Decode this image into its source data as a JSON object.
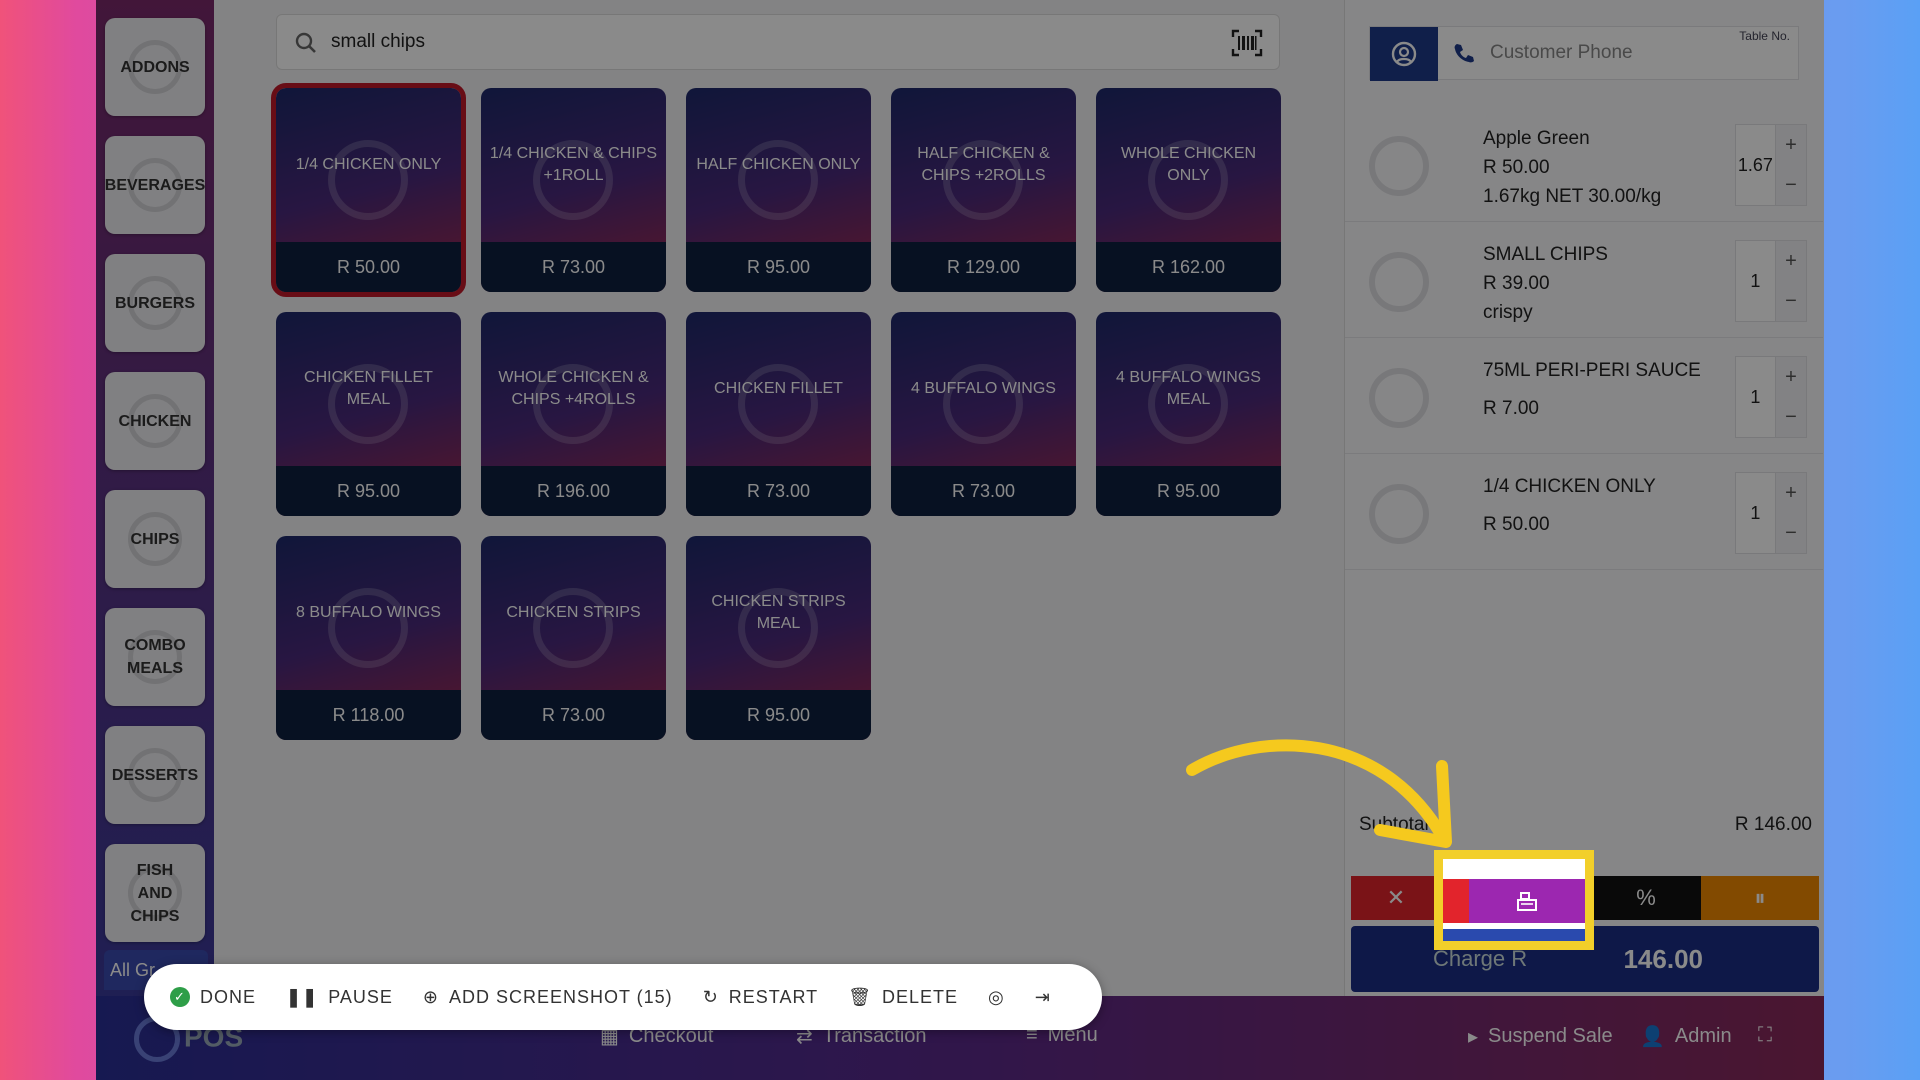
{
  "sidebar": {
    "categories": [
      "ADDONS",
      "BEVERAGES",
      "BURGERS",
      "CHICKEN",
      "CHIPS",
      "COMBO MEALS",
      "DESSERTS",
      "FISH AND CHIPS"
    ],
    "all_groups": "All Gr"
  },
  "search": {
    "value": "small chips"
  },
  "products": [
    {
      "name": "1/4 CHICKEN ONLY",
      "price": "R 50.00"
    },
    {
      "name": "1/4 CHICKEN & CHIPS +1ROLL",
      "price": "R 73.00"
    },
    {
      "name": "HALF CHICKEN ONLY",
      "price": "R 95.00"
    },
    {
      "name": "HALF CHICKEN & CHIPS +2ROLLS",
      "price": "R 129.00"
    },
    {
      "name": "WHOLE CHICKEN ONLY",
      "price": "R 162.00"
    },
    {
      "name": "CHICKEN FILLET MEAL",
      "price": "R 95.00"
    },
    {
      "name": "WHOLE CHICKEN & CHIPS +4ROLLS",
      "price": "R 196.00"
    },
    {
      "name": "CHICKEN FILLET",
      "price": "R 73.00"
    },
    {
      "name": "4 BUFFALO WINGS",
      "price": "R 73.00"
    },
    {
      "name": "4 BUFFALO WINGS MEAL",
      "price": "R 95.00"
    },
    {
      "name": "8 BUFFALO WINGS",
      "price": "R 118.00"
    },
    {
      "name": "CHICKEN STRIPS",
      "price": "R 73.00"
    },
    {
      "name": "CHICKEN STRIPS MEAL",
      "price": "R 95.00"
    }
  ],
  "customer": {
    "placeholder": "Customer Phone",
    "table_label": "Table No."
  },
  "cart": [
    {
      "name": "Apple Green",
      "price": "R 50.00",
      "note": "1.67kg NET 30.00/kg",
      "qty": "1.67"
    },
    {
      "name": "SMALL CHIPS",
      "price": "R 39.00",
      "note": "crispy",
      "qty": "1"
    },
    {
      "name": "75ML PERI-PERI SAUCE",
      "price": "R 7.00",
      "note": "",
      "qty": "1"
    },
    {
      "name": "1/4 CHICKEN ONLY",
      "price": "R 50.00",
      "note": "",
      "qty": "1"
    }
  ],
  "totals": {
    "subtotal_label": "Subtotal",
    "subtotal": "R 146.00"
  },
  "charge": {
    "label": "Charge R",
    "amount": "146.00"
  },
  "bottomnav": {
    "logo": "POS",
    "checkout": "Checkout",
    "transaction": "Transaction",
    "menu": "Menu",
    "suspend": "Suspend Sale",
    "admin": "Admin"
  },
  "recorder": {
    "done": "DONE",
    "pause": "PAUSE",
    "add_screenshot": "ADD SCREENSHOT (15)",
    "restart": "RESTART",
    "delete": "DELETE"
  },
  "colors": {
    "accent_blue": "#1a2e86",
    "action_red": "#e2242c",
    "action_purple": "#9c27b0",
    "action_black": "#111111",
    "action_orange": "#f08a00",
    "highlight_yellow": "#f2cf2a"
  }
}
